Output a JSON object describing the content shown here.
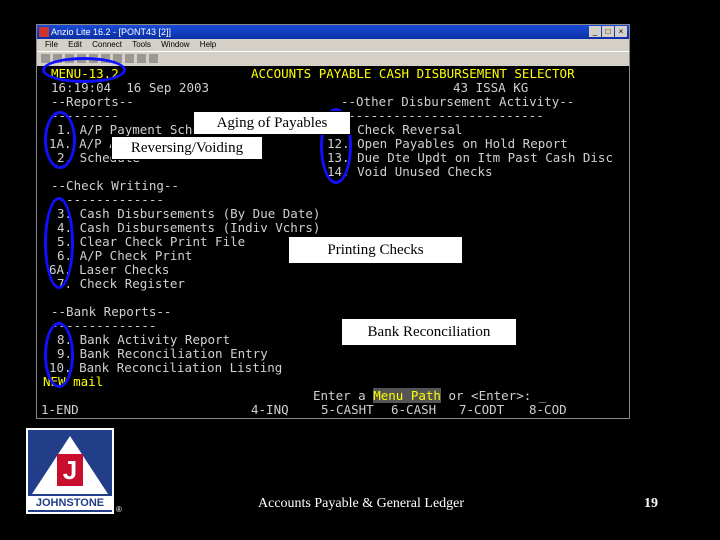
{
  "window": {
    "title": "Anzio Lite 16.2 - [PONT43 [2]]",
    "menu": [
      "File",
      "Edit",
      "Connect",
      "Tools",
      "Window",
      "Help"
    ]
  },
  "terminal": {
    "menu_id": "MENU-13.2",
    "screen_title": "ACCOUNTS PAYABLE CASH DISBURSEMENT SELECTOR",
    "time_date": "16:19:04  16 Sep 2003",
    "company": "43 ISSA KG",
    "reports_header": "--Reports--",
    "reports_underline": "---------",
    "other_header": "--Other Disbursement Activity--",
    "other_underline": "----------------------------",
    "left_items": [
      "1. A/P Payment Schedule",
      "1A. A/P Aging",
      "2. Schedule"
    ],
    "right_items": [
      "11. Check Reversal",
      "12. Open Payables on Hold Report",
      "13. Due Dte Updt on Itm Past Cash Disc",
      "14. Void Unused Checks"
    ],
    "check_header": "--Check Writing--",
    "check_underline": "---------------",
    "check_items": [
      "3. Cash Disbursements (By Due Date)",
      "4. Cash Disbursements (Indiv Vchrs)",
      "5. Clear Check Print File",
      "6. A/P Check Print",
      "6A. Laser Checks",
      "7. Check Register"
    ],
    "bank_header": "--Bank Reports--",
    "bank_underline": "--------------",
    "bank_items": [
      "8. Bank Activity Report",
      "9. Bank Reconciliation Entry",
      "10. Bank Reconciliation Listing"
    ],
    "new_mail": "NEW mail",
    "prompt_before": "Enter a ",
    "prompt_highlight": "Menu Path",
    "prompt_after": " or <Enter>: _",
    "fkeys": [
      "1-END",
      "4-INQ",
      "5-CASHT",
      "6-CASH",
      "7-CODT",
      "8-COD"
    ]
  },
  "callouts": {
    "aging": "Aging of Payables",
    "reversing": "Reversing/Voiding",
    "printing": "Printing Checks",
    "bank": "Bank Reconciliation"
  },
  "footer": {
    "logo_name": "JOHNSTONE",
    "logo_letter": "J",
    "registered": "®",
    "caption": "Accounts Payable & General Ledger",
    "page_number": "19"
  },
  "colors": {
    "ellipse": "#1010ff",
    "terminal_text": "#d0d0d0",
    "highlight": "#ffff00"
  }
}
